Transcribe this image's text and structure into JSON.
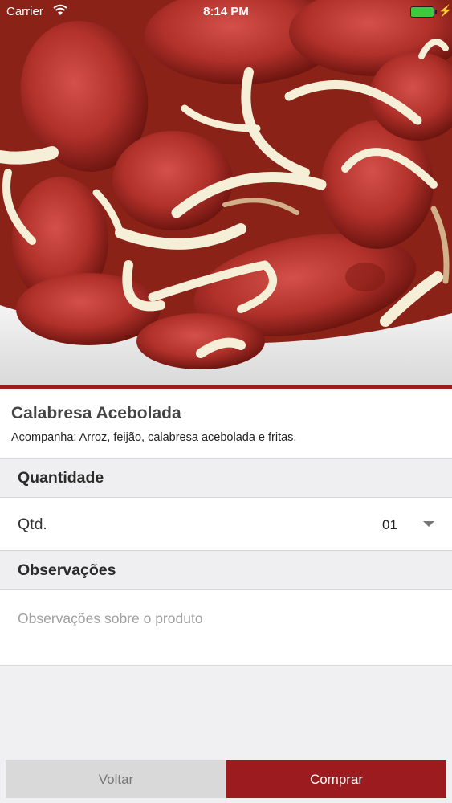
{
  "status_bar": {
    "carrier": "Carrier",
    "time": "8:14 PM",
    "icons": [
      "wifi-icon",
      "battery-icon",
      "charge-icon"
    ]
  },
  "hero": {
    "image": "product-photo-calabresa-acebolada",
    "accent_color": "#9b1b1f"
  },
  "product": {
    "title": "Calabresa Acebolada",
    "description": "Acompanha: Arroz, feijão, calabresa acebolada e fritas."
  },
  "quantity_section": {
    "header": "Quantidade",
    "label": "Qtd.",
    "value": "01"
  },
  "notes_section": {
    "header": "Observações",
    "placeholder": "Observações sobre o produto",
    "value": ""
  },
  "footer": {
    "back_label": "Voltar",
    "buy_label": "Comprar",
    "buy_color": "#9b1b1f"
  }
}
